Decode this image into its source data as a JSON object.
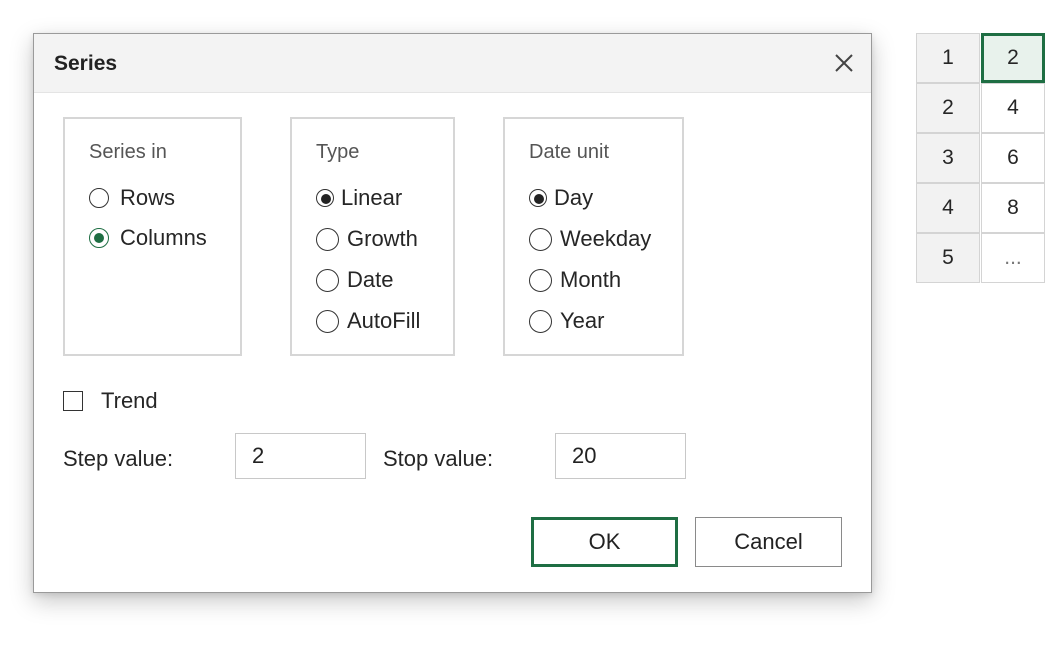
{
  "dialog": {
    "title": "Series",
    "series_in": {
      "label": "Series in",
      "options": [
        {
          "label": "Rows",
          "checked": false
        },
        {
          "label": "Columns",
          "checked": true
        }
      ]
    },
    "type": {
      "label": "Type",
      "options": [
        {
          "label": "Linear",
          "checked": true
        },
        {
          "label": "Growth",
          "checked": false
        },
        {
          "label": "Date",
          "checked": false
        },
        {
          "label": "AutoFill",
          "checked": false
        }
      ]
    },
    "date_unit": {
      "label": "Date unit",
      "options": [
        {
          "label": "Day",
          "checked": true
        },
        {
          "label": "Weekday",
          "checked": false
        },
        {
          "label": "Month",
          "checked": false
        },
        {
          "label": "Year",
          "checked": false
        }
      ]
    },
    "trend": {
      "label": "Trend",
      "checked": false
    },
    "step": {
      "label": "Step value:",
      "value": "2"
    },
    "stop": {
      "label": "Stop value:",
      "value": "20"
    },
    "ok_label": "OK",
    "cancel_label": "Cancel"
  },
  "sheet": {
    "rows": [
      {
        "header": "1",
        "value": "2",
        "selected": true
      },
      {
        "header": "2",
        "value": "4",
        "selected": false
      },
      {
        "header": "3",
        "value": "6",
        "selected": false
      },
      {
        "header": "4",
        "value": "8",
        "selected": false
      },
      {
        "header": "5",
        "value": "...",
        "selected": false
      }
    ]
  },
  "colors": {
    "accent": "#1e6e43",
    "titlebar": "#f3f3f3",
    "header_cell": "#f2f2f2"
  },
  "icons": {
    "close": "close-icon"
  }
}
